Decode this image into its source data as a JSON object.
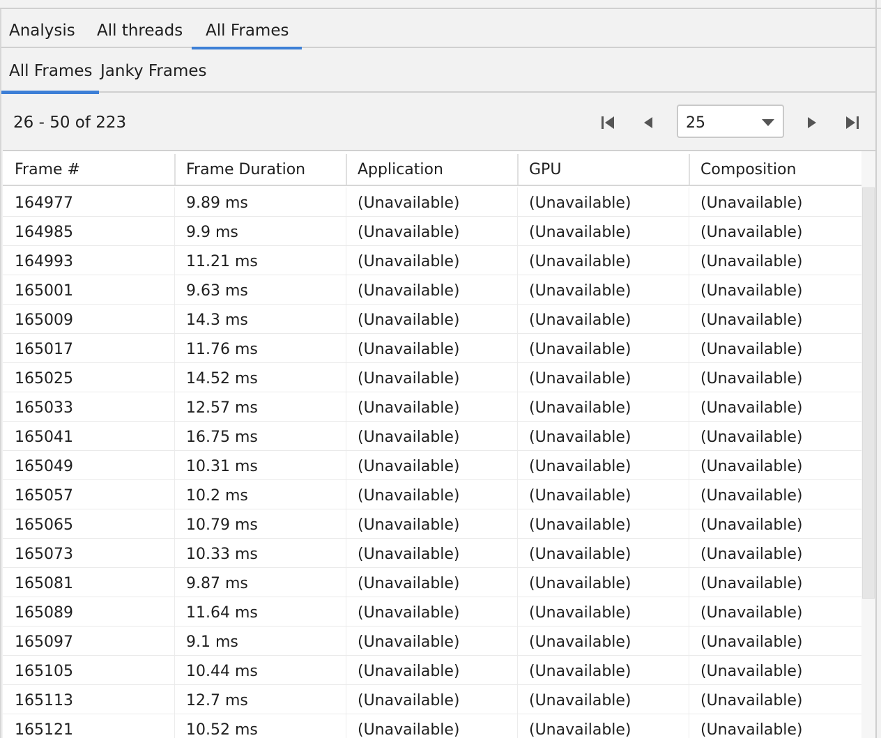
{
  "tabs": {
    "analysis": "Analysis",
    "all_threads": "All threads",
    "all_frames": "All Frames"
  },
  "subtabs": {
    "all_frames": "All Frames",
    "janky_frames": "Janky Frames"
  },
  "pager": {
    "range_text": "26 - 50 of 223",
    "page_size": "25"
  },
  "table": {
    "columns": [
      "Frame #",
      "Frame Duration",
      "Application",
      "GPU",
      "Composition"
    ],
    "rows": [
      [
        "164977",
        "9.89 ms",
        "(Unavailable)",
        "(Unavailable)",
        "(Unavailable)"
      ],
      [
        "164985",
        "9.9 ms",
        "(Unavailable)",
        "(Unavailable)",
        "(Unavailable)"
      ],
      [
        "164993",
        "11.21 ms",
        "(Unavailable)",
        "(Unavailable)",
        "(Unavailable)"
      ],
      [
        "165001",
        "9.63 ms",
        "(Unavailable)",
        "(Unavailable)",
        "(Unavailable)"
      ],
      [
        "165009",
        "14.3 ms",
        "(Unavailable)",
        "(Unavailable)",
        "(Unavailable)"
      ],
      [
        "165017",
        "11.76 ms",
        "(Unavailable)",
        "(Unavailable)",
        "(Unavailable)"
      ],
      [
        "165025",
        "14.52 ms",
        "(Unavailable)",
        "(Unavailable)",
        "(Unavailable)"
      ],
      [
        "165033",
        "12.57 ms",
        "(Unavailable)",
        "(Unavailable)",
        "(Unavailable)"
      ],
      [
        "165041",
        "16.75 ms",
        "(Unavailable)",
        "(Unavailable)",
        "(Unavailable)"
      ],
      [
        "165049",
        "10.31 ms",
        "(Unavailable)",
        "(Unavailable)",
        "(Unavailable)"
      ],
      [
        "165057",
        "10.2 ms",
        "(Unavailable)",
        "(Unavailable)",
        "(Unavailable)"
      ],
      [
        "165065",
        "10.79 ms",
        "(Unavailable)",
        "(Unavailable)",
        "(Unavailable)"
      ],
      [
        "165073",
        "10.33 ms",
        "(Unavailable)",
        "(Unavailable)",
        "(Unavailable)"
      ],
      [
        "165081",
        "9.87 ms",
        "(Unavailable)",
        "(Unavailable)",
        "(Unavailable)"
      ],
      [
        "165089",
        "11.64 ms",
        "(Unavailable)",
        "(Unavailable)",
        "(Unavailable)"
      ],
      [
        "165097",
        "9.1 ms",
        "(Unavailable)",
        "(Unavailable)",
        "(Unavailable)"
      ],
      [
        "165105",
        "10.44 ms",
        "(Unavailable)",
        "(Unavailable)",
        "(Unavailable)"
      ],
      [
        "165113",
        "12.7 ms",
        "(Unavailable)",
        "(Unavailable)",
        "(Unavailable)"
      ],
      [
        "165121",
        "10.52 ms",
        "(Unavailable)",
        "(Unavailable)",
        "(Unavailable)"
      ]
    ]
  },
  "colors": {
    "accent": "#3d7fd6",
    "panel_bg": "#f2f2f2",
    "table_bg": "#ffffff"
  },
  "icons": {
    "first_page": "first-page-icon",
    "prev_page": "prev-page-icon",
    "dropdown": "chevron-down-icon",
    "next_page": "next-page-icon",
    "last_page": "last-page-icon"
  }
}
